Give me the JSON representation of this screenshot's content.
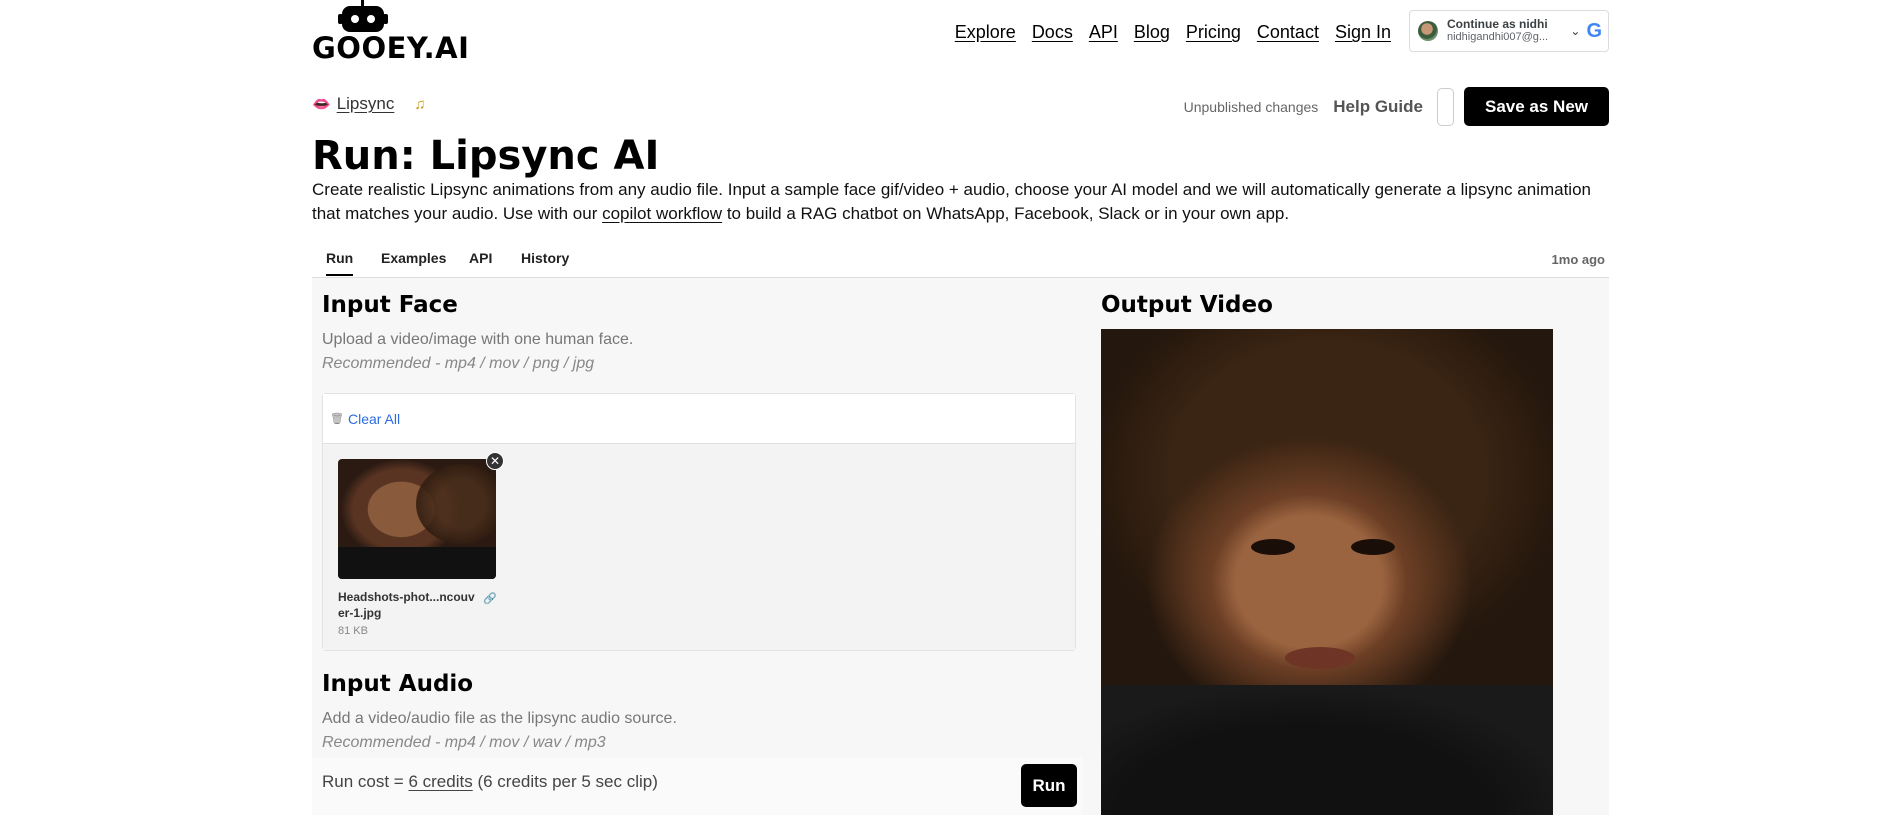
{
  "brand": {
    "name": "GOOEY.AI"
  },
  "nav": [
    "Explore",
    "Docs",
    "API",
    "Blog",
    "Pricing",
    "Contact",
    "Sign In"
  ],
  "google": {
    "title": "Continue as nidhi",
    "email": "nidhigandhi007@g...",
    "logo": "G"
  },
  "breadcrumb": {
    "label": "Lipsync"
  },
  "actions": {
    "status": "Unpublished changes",
    "help": "Help Guide",
    "save": "Save as New"
  },
  "page": {
    "title": "Run: Lipsync AI",
    "desc_before": "Create realistic Lipsync animations from any audio file. Input a sample face gif/video + audio, choose your AI model and we will automatically generate a lipsync animation that matches your audio. Use with our ",
    "desc_link": "copilot workflow",
    "desc_after": " to build a RAG chatbot on WhatsApp, Facebook, Slack or in your own app."
  },
  "tabs": [
    "Run",
    "Examples",
    "API",
    "History"
  ],
  "tab_time": "1mo ago",
  "input_face": {
    "heading": "Input Face",
    "hint": "Upload a video/image with one human face.",
    "formats": "Recommended - mp4 / mov / png / jpg",
    "clear": "Clear All",
    "file_name": "Headshots-phot...ncouver-1.jpg",
    "file_size": "81 KB"
  },
  "input_audio": {
    "heading": "Input Audio",
    "hint": "Add a video/audio file as the lipsync audio source.",
    "formats": "Recommended - mp4 / mov / wav / mp3"
  },
  "run": {
    "prefix": "Run cost = ",
    "credits": "6 credits",
    "suffix": " (6 credits per 5 sec clip)",
    "button": "Run"
  },
  "output": {
    "heading": "Output Video"
  }
}
